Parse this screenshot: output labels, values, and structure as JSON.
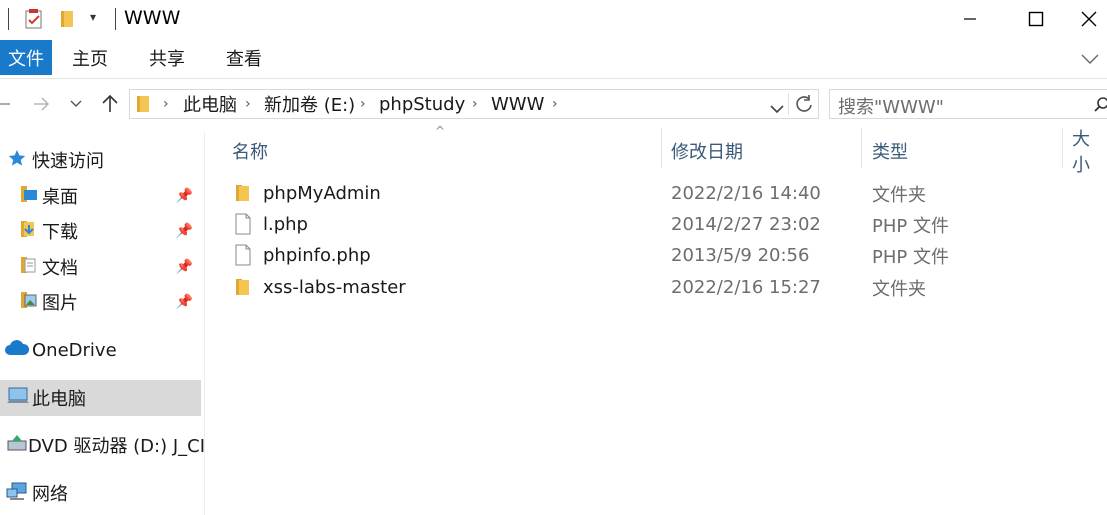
{
  "window": {
    "title": "WWW"
  },
  "ribbon": {
    "tabs": [
      "文件",
      "主页",
      "共享",
      "查看"
    ]
  },
  "address": {
    "crumbs": [
      "此电脑",
      "新加卷 (E:)",
      "phpStudy",
      "WWW"
    ]
  },
  "search": {
    "placeholder": "搜索\"WWW\""
  },
  "sidebar": {
    "quick_access": "快速访问",
    "pinned": [
      "桌面",
      "下载",
      "文档",
      "图片"
    ],
    "onedrive": "OneDrive",
    "this_pc": "此电脑",
    "dvd": "DVD 驱动器 (D:) J_CI",
    "network": "网络"
  },
  "columns": {
    "name": "名称",
    "modified": "修改日期",
    "type": "类型",
    "size": "大小"
  },
  "files": [
    {
      "name": "phpMyAdmin",
      "modified": "2022/2/16 14:40",
      "type": "文件夹",
      "icon": "folder-icon"
    },
    {
      "name": "l.php",
      "modified": "2014/2/27 23:02",
      "type": "PHP 文件",
      "icon": "file-icon"
    },
    {
      "name": "phpinfo.php",
      "modified": "2013/5/9 20:56",
      "type": "PHP 文件",
      "icon": "file-icon"
    },
    {
      "name": "xss-labs-master",
      "modified": "2022/2/16 15:27",
      "type": "文件夹",
      "icon": "folder-icon"
    }
  ],
  "colors": {
    "accent": "#1979ca",
    "folder": "#f4c552",
    "selected_nav": "#d9d9d9"
  }
}
